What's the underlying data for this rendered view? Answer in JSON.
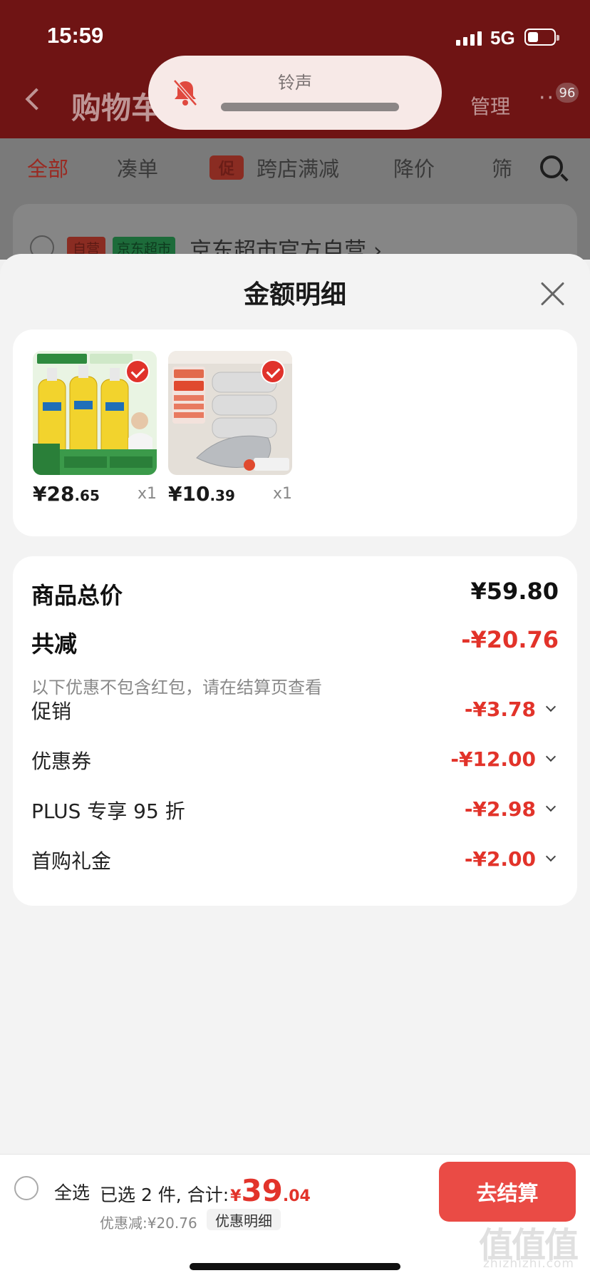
{
  "status_bar": {
    "time": "15:59",
    "network": "5G"
  },
  "ringer": {
    "label": "铃声"
  },
  "header": {
    "title": "购物车",
    "manage": "管理",
    "more": "···",
    "badge": "96"
  },
  "tabs": [
    {
      "label": "全部"
    },
    {
      "label": "凑单"
    },
    {
      "label": "促"
    },
    {
      "label": "跨店满减"
    },
    {
      "label": "降价"
    },
    {
      "label": "筛"
    }
  ],
  "store": {
    "tag_self": "自营",
    "tag_jd": "京东超市",
    "name": "京东超市官方自营 ›"
  },
  "sheet": {
    "title": "金额明细"
  },
  "products": [
    {
      "price_int": "¥28",
      "price_dec": ".65",
      "qty": "x1"
    },
    {
      "price_int": "¥10",
      "price_dec": ".39",
      "qty": "x1"
    }
  ],
  "summary": {
    "total_label": "商品总价",
    "total_value": "¥59.80",
    "reduce_label": "共减",
    "reduce_value": "-¥20.76",
    "note": "以下优惠不包含红包，请在结算页查看",
    "items": [
      {
        "label": "促销",
        "value": "-¥3.78"
      },
      {
        "label": "优惠券",
        "value": "-¥12.00"
      },
      {
        "label": "PLUS 专享 95 折",
        "value": "-¥2.98"
      },
      {
        "label": "首购礼金",
        "value": "-¥2.00"
      }
    ]
  },
  "footer": {
    "select_all": "全选",
    "selected_text": "已选 2 件, 合计:",
    "currency": "¥",
    "total_int": "39",
    "total_dec": ".04",
    "discount_text": "优惠减:¥20.76",
    "detail_link": "优惠明细",
    "checkout": "去结算"
  },
  "watermark": {
    "glyphs": "值值值",
    "url": "zhizhizhi.com"
  },
  "colors": {
    "accent": "#e2332a",
    "checkout_bg": "#ea4b45",
    "header_bg": "#6f1414"
  }
}
